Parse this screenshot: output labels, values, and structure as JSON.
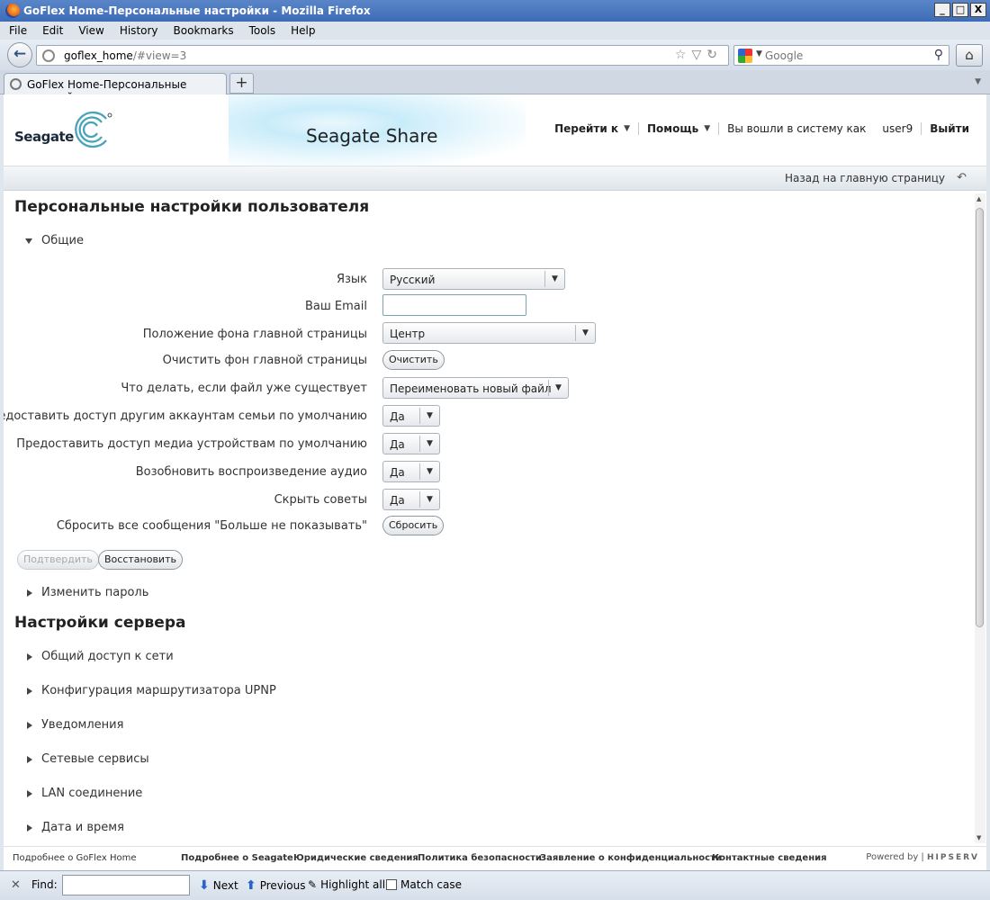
{
  "window": {
    "title": "GoFlex Home-Персональные настройки - Mozilla Firefox",
    "controls": [
      "_",
      "□",
      "X"
    ]
  },
  "menu": [
    "File",
    "Edit",
    "View",
    "History",
    "Bookmarks",
    "Tools",
    "Help"
  ],
  "nav": {
    "url_host": "goflex_home",
    "url_rest": "/#view=3",
    "search_placeholder": "Google"
  },
  "tabs": [
    {
      "label": "GoFlex Home-Персональные настройки"
    }
  ],
  "header": {
    "brand": "Seagate",
    "app_name": "Seagate Share",
    "goto": "Перейти к",
    "help": "Помощь",
    "logged_in_as": "Вы вошли в систему как",
    "user": "user9",
    "logout": "Выйти"
  },
  "backbar": {
    "label": "Назад на главную страницу"
  },
  "page": {
    "title": "Персональные настройки пользователя",
    "general_section": "Общие",
    "fields": [
      {
        "label": "Язык",
        "type": "select",
        "value": "Русский"
      },
      {
        "label": "Ваш Email",
        "type": "input",
        "value": ""
      },
      {
        "label": "Положение фона главной страницы",
        "type": "select",
        "value": "Центр"
      },
      {
        "label": "Очистить фон главной страницы",
        "type": "button",
        "value": "Очистить"
      },
      {
        "label": "Что делать, если файл уже существует",
        "type": "select",
        "value": "Переименовать новый файл"
      },
      {
        "label": "Предоставить доступ другим аккаунтам семьи по умолчанию",
        "type": "select",
        "value": "Да"
      },
      {
        "label": "Предоставить доступ медиа устройствам по умолчанию",
        "type": "select",
        "value": "Да"
      },
      {
        "label": "Возобновить воспроизведение аудио",
        "type": "select",
        "value": "Да"
      },
      {
        "label": "Скрыть советы",
        "type": "select",
        "value": "Да"
      },
      {
        "label": "Сбросить все сообщения \"Больше не показывать\"",
        "type": "button",
        "value": "Сбросить"
      }
    ],
    "confirm_label": "Подтвердить",
    "restore_label": "Восстановить",
    "change_password": "Изменить пароль",
    "server_title": "Настройки сервера",
    "server_sections": [
      "Общий доступ к сети",
      "Конфигурация маршрутизатора UPNP",
      "Уведомления",
      "Сетевые сервисы",
      "LAN соединение",
      "Дата и время"
    ]
  },
  "footer": {
    "about": "Подробнее о GoFlex Home",
    "links": [
      "Подробнее о Seagate",
      "Юридические сведения",
      "Политика безопасности",
      "Заявление о конфиденциальности",
      "Контактные сведения"
    ],
    "powered_by": "Powered by |",
    "hipserv": "HIPSERV"
  },
  "findbar": {
    "find_label": "Find:",
    "next": "Next",
    "previous": "Previous",
    "highlight_all": "Highlight all",
    "match_case": "Match case"
  }
}
